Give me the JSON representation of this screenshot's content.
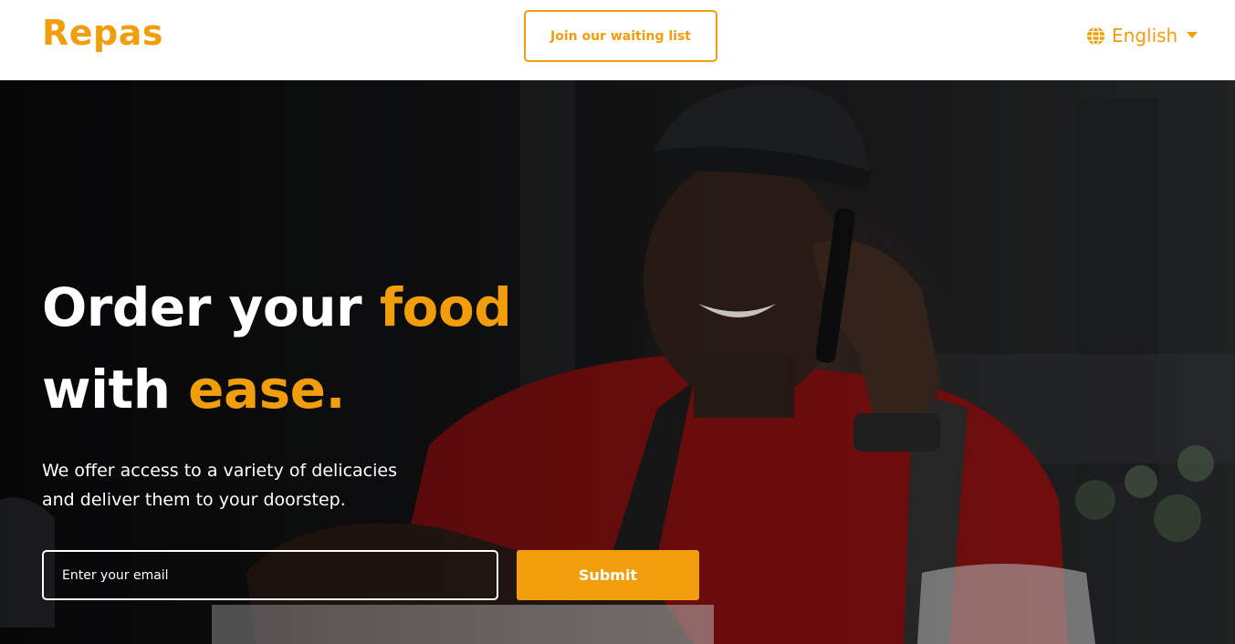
{
  "header": {
    "logo": "Repas",
    "waitlist_label": "Join our waiting list",
    "language": {
      "icon": "globe-icon",
      "selected": "English",
      "caret_icon": "caret-down-icon"
    }
  },
  "hero": {
    "headline": {
      "line1_plain": "Order your ",
      "line1_accent": "food",
      "line2_plain": "with ",
      "line2_accent": "ease."
    },
    "subtext_line1": "We offer access to a variety of delicacies",
    "subtext_line2": "and deliver them to your doorstep.",
    "email_placeholder": "Enter your email",
    "submit_label": "Submit"
  },
  "colors": {
    "accent": "#f29d0c",
    "text_light": "#ffffff",
    "header_bg": "#ffffff"
  }
}
